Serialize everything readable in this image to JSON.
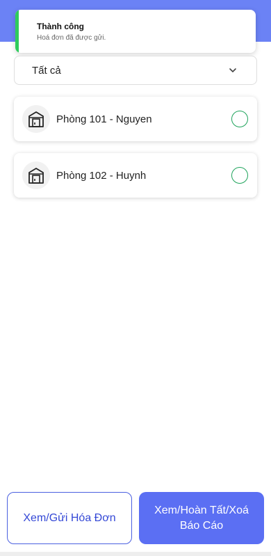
{
  "toast": {
    "title": "Thành công",
    "message": "Hoá đơn đã được gửi."
  },
  "filter": {
    "selected": "Tất cả"
  },
  "rooms": [
    {
      "label": "Phòng 101 - Nguyen"
    },
    {
      "label": "Phòng 102 - Huynh"
    }
  ],
  "actions": {
    "invoice_label": "Xem/Gửi Hóa Đơn",
    "report_label": "Xem/Hoàn Tất/Xoá Báo Cáo"
  },
  "icons": {
    "filter": "chevron-down-icon",
    "room": "house-door-icon",
    "select": "circle-check-icon"
  },
  "colors": {
    "header": "#6b82f5",
    "toast_accent": "#2ecc5c",
    "check": "#1ea35b",
    "primary": "#5b6ff3",
    "outline": "#4a5fe0"
  }
}
